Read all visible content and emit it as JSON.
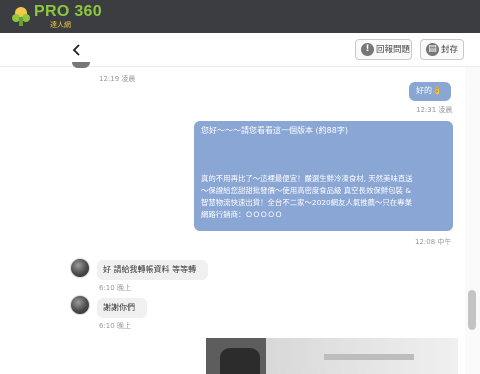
{
  "brand": {
    "logo_text": "PRO 360",
    "logo_sub": "達人網"
  },
  "header": {
    "back_icon": "chevron-left-icon",
    "report_label": "回報問題",
    "archive_label": "封存"
  },
  "messages": [
    {
      "time": "12:19 凌晨"
    },
    {
      "text": "好的👌",
      "time": "12:31 凌晨"
    },
    {
      "lines": [
        "您好～～～請您看看這一個版本 (約88字)",
        "",
        "",
        "",
        "真的不用再比了～這裡最便宜！嚴選生鮮冷凍食材, 天然美味直送",
        "～保證給您甜甜批發價～使用高密度食品級 真空長效保鮮包裝 &",
        "智慧物流快速出貨！全台不二家～2020網友人氣推薦～只在專業",
        "網路行銷商：ＯＯＯＯＯ"
      ],
      "time": "12:08 中午"
    },
    {
      "text": "好 請給我轉帳資料 等等轉",
      "time": "6:10 晚上"
    },
    {
      "text": "謝謝你們",
      "time": "6:10 晚上"
    }
  ],
  "colors": {
    "topbar": "#3b3d40",
    "outgoing_bubble": "#8aa6d4",
    "incoming_bubble": "#f0f0f0",
    "brand_green": "#8dc63f"
  }
}
